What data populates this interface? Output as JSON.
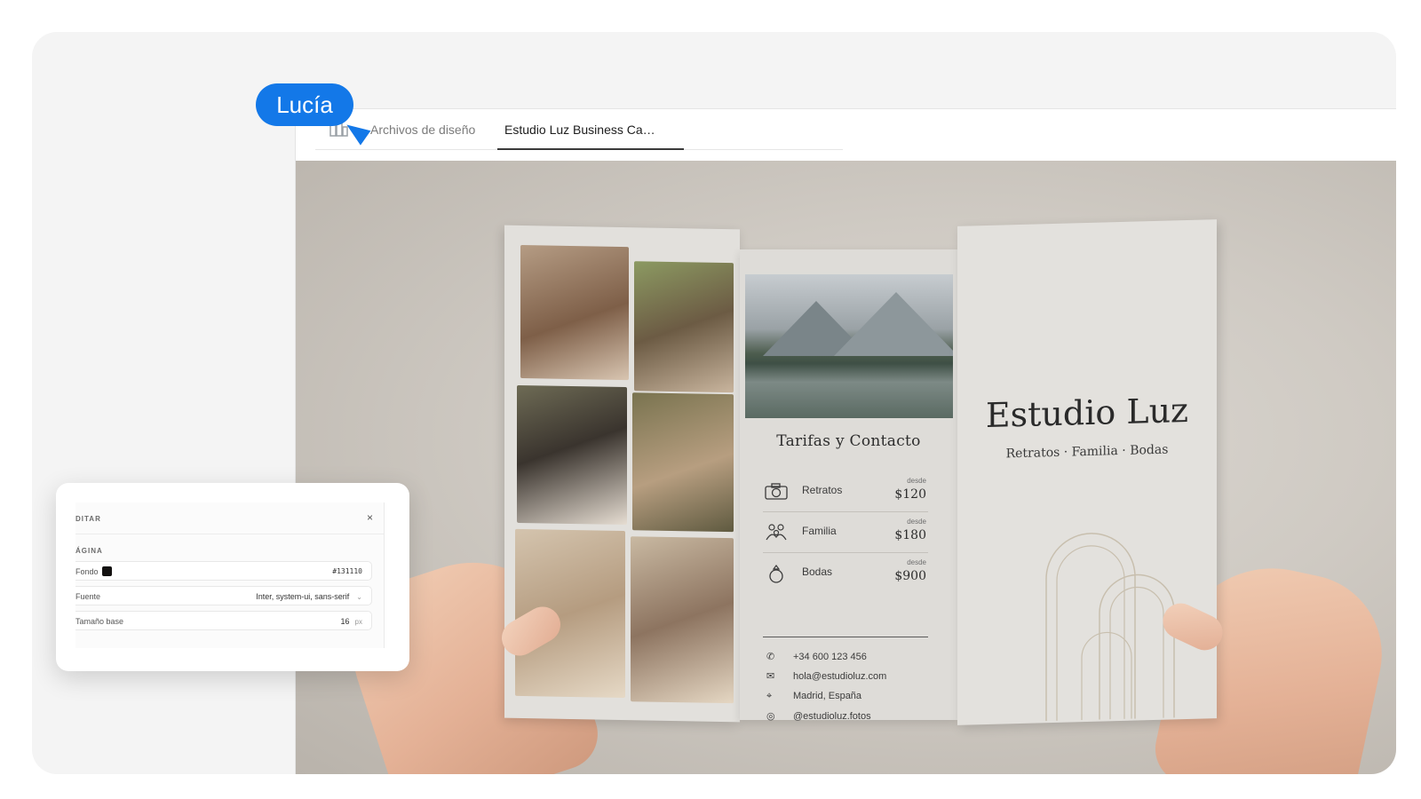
{
  "tabs": {
    "files": "Archivos de diseño",
    "active": "Estudio Luz Business Ca…"
  },
  "brochure": {
    "heading": "Tarifas y Contacto",
    "rates": [
      {
        "icon": "camera-icon",
        "name": "Retratos",
        "from": "desde",
        "price": "$120"
      },
      {
        "icon": "family-icon",
        "name": "Familia",
        "from": "desde",
        "price": "$180"
      },
      {
        "icon": "ring-icon",
        "name": "Bodas",
        "from": "desde",
        "price": "$900"
      }
    ],
    "contacts": {
      "phone": "+34 600 123 456",
      "email": "hola@estudioluz.com",
      "location": "Madrid, España",
      "instagram": "@estudioluz.fotos"
    },
    "studio_name": "Estudio Luz",
    "studio_sub": "Retratos · Familia · Bodas"
  },
  "editor": {
    "title": "DITAR",
    "close": "×",
    "section": "ÁGINA",
    "background": {
      "label": "Fondo",
      "value": "#131110"
    },
    "font": {
      "label": "Fuente",
      "value": "Inter, system-ui, sans-serif"
    },
    "base_size": {
      "label": "Tamaño base",
      "value": "16",
      "unit": "px"
    }
  },
  "cursor": {
    "user": "Lucía",
    "color": "#1378e8"
  }
}
